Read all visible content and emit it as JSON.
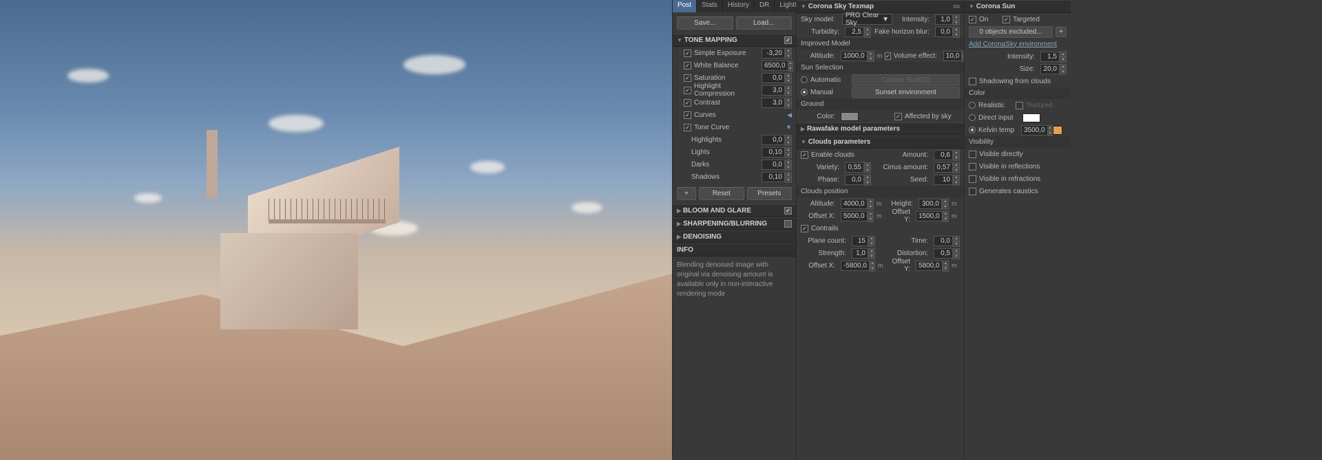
{
  "tabs": {
    "post": "Post",
    "stats": "Stats",
    "history": "History",
    "dr": "DR",
    "lightmix": "LightMix"
  },
  "buttons": {
    "save": "Save...",
    "load": "Load...",
    "plus": "+",
    "reset": "Reset",
    "presets": "Presets"
  },
  "sections": {
    "tone": "TONE MAPPING",
    "bloom": "BLOOM AND GLARE",
    "sharp": "SHARPENING/BLURRING",
    "denoise": "DENOISING",
    "info": "INFO"
  },
  "tone": {
    "simple_exposure": {
      "label": "Simple Exposure",
      "value": "-3,20"
    },
    "white_balance": {
      "label": "White Balance",
      "value": "6500,0"
    },
    "saturation": {
      "label": "Saturation",
      "value": "0,0"
    },
    "highlight_comp": {
      "label": "Highlight Compression",
      "value": "3,0"
    },
    "contrast": {
      "label": "Contrast",
      "value": "3,0"
    },
    "curves": {
      "label": "Curves"
    },
    "tone_curve": {
      "label": "Tone Curve"
    },
    "highlights": {
      "label": "Highlights",
      "value": "0,0"
    },
    "lights": {
      "label": "Lights",
      "value": "0,10"
    },
    "darks": {
      "label": "Darks",
      "value": "0,0"
    },
    "shadows": {
      "label": "Shadows",
      "value": "0,10"
    }
  },
  "info_text": "Blending denoised image with original via denoising amount is available only in non-interactive rendering mode",
  "sky": {
    "title": "Corona Sky Texmap",
    "sky_model": {
      "label": "Sky model:",
      "value": "PRG Clear Sky"
    },
    "intensity": {
      "label": "Intensity:",
      "value": "1,0"
    },
    "turbidity": {
      "label": "Turbidity:",
      "value": "2,5"
    },
    "fake_horizon": {
      "label": "Fake horizon blur:",
      "value": "0,0"
    },
    "improved": "Improved Model",
    "altitude": {
      "label": "Altitude:",
      "value": "1000,0",
      "unit": "m"
    },
    "volume": {
      "label": "Volume effect:",
      "value": "10,0"
    },
    "sun_sel": "Sun Selection",
    "automatic": "Automatic",
    "manual": "Manual",
    "sun_node": "Corona Sun001",
    "sunset_env": "Sunset environment",
    "ground": "Ground",
    "color": {
      "label": "Color:",
      "value": "#888888"
    },
    "affected": "Affected by sky",
    "rawafake": "Rawafake model parameters",
    "clouds_params": "Clouds parameters",
    "enable_clouds": "Enable clouds",
    "amount": {
      "label": "Amount:",
      "value": "0,6"
    },
    "variety": {
      "label": "Variety:",
      "value": "0,55"
    },
    "cirrus": {
      "label": "Cirrus amount:",
      "value": "0,57"
    },
    "phase": {
      "label": "Phase:",
      "value": "0,0"
    },
    "seed": {
      "label": "Seed:",
      "value": "10"
    },
    "clouds_pos": "Clouds position",
    "cloud_alt": {
      "label": "Altitude:",
      "value": "4000,0",
      "unit": "m"
    },
    "height": {
      "label": "Height:",
      "value": "300,0",
      "unit": "m"
    },
    "offsetx": {
      "label": "Offset X:",
      "value": "5000,0",
      "unit": "m"
    },
    "offsety": {
      "label": "Offset Y:",
      "value": "1500,0",
      "unit": "m"
    },
    "contrails": "Contrails",
    "plane_count": {
      "label": "Plane count:",
      "value": "15"
    },
    "time": {
      "label": "Time:",
      "value": "0,0"
    },
    "strength": {
      "label": "Strength:",
      "value": "1,0"
    },
    "distortion": {
      "label": "Distortion:",
      "value": "0,5"
    },
    "c_offsetx": {
      "label": "Offset X:",
      "value": "-5800,0",
      "unit": "m"
    },
    "c_offsety": {
      "label": "Offset Y:",
      "value": "5800,0",
      "unit": "m"
    }
  },
  "sun": {
    "title": "Corona Sun",
    "on": "On",
    "targeted": "Targeted",
    "excluded": "0 objects excluded...",
    "add_env": "Add CoronaSky environment",
    "intensity": {
      "label": "Intensity:",
      "value": "1,5"
    },
    "size": {
      "label": "Size:",
      "value": "20,0"
    },
    "shadowing": "Shadowing from clouds",
    "color": "Color",
    "realistic": "Realistic",
    "textured": "Textured",
    "direct": "Direct input",
    "kelvin": {
      "label": "Kelvin temp",
      "value": "3500,0"
    },
    "visibility": "Visibility",
    "vis_direct": "Visible directly",
    "vis_refl": "Visible in reflections",
    "vis_refr": "Visible in refractions",
    "caustics": "Generates caustics"
  }
}
